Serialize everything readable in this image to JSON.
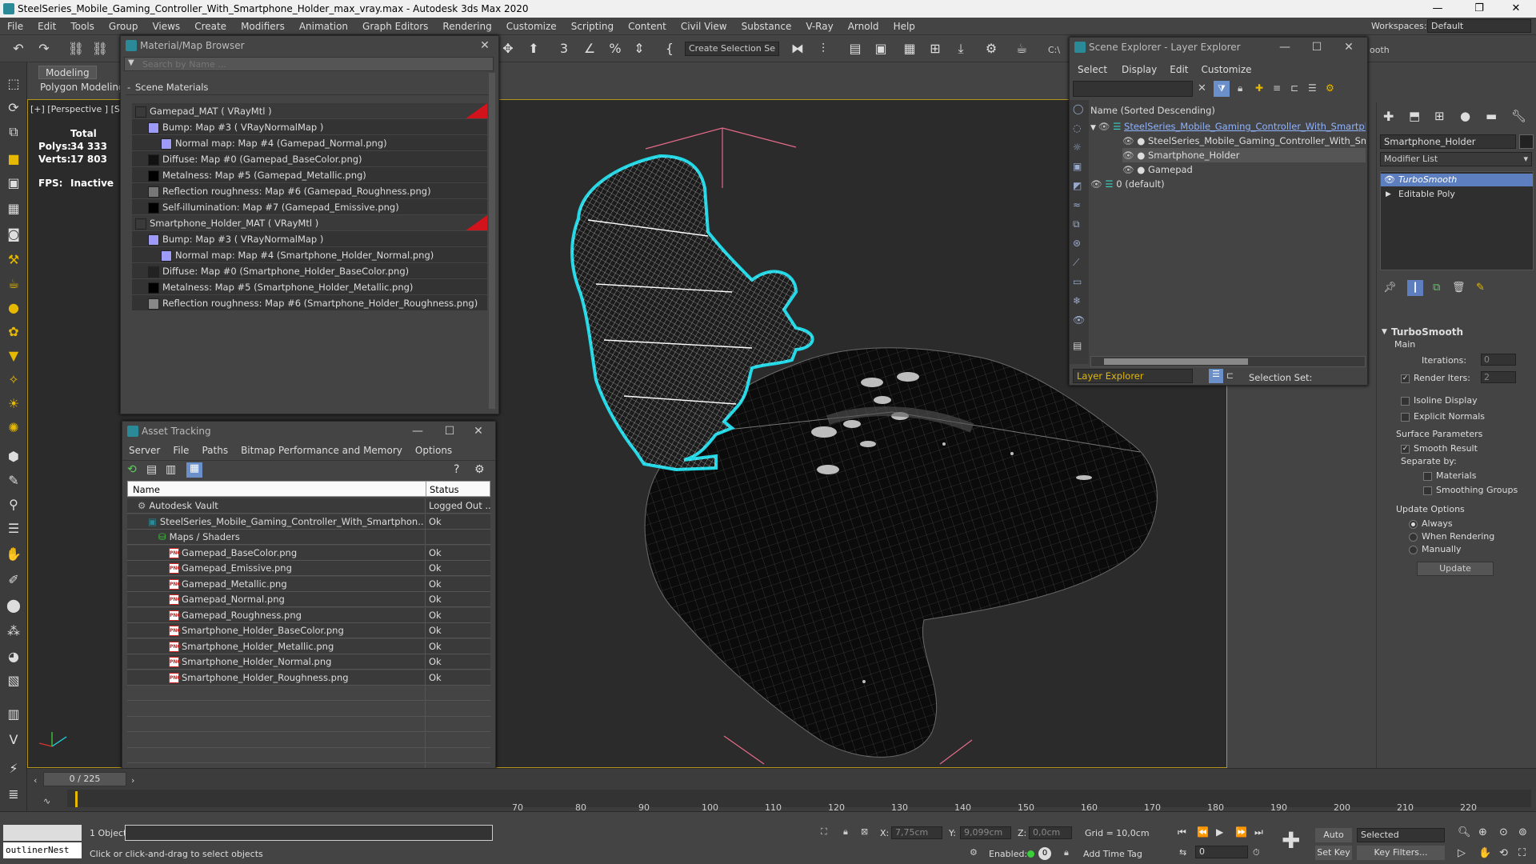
{
  "window": {
    "title": "SteelSeries_Mobile_Gaming_Controller_With_Smartphone_Holder_max_vray.max - Autodesk 3ds Max 2020",
    "workspace_label": "Workspaces:",
    "workspace_value": "Default"
  },
  "menu": [
    "File",
    "Edit",
    "Tools",
    "Group",
    "Views",
    "Create",
    "Modifiers",
    "Animation",
    "Graph Editors",
    "Rendering",
    "Customize",
    "Scripting",
    "Content",
    "Civil View",
    "Substance",
    "V-Ray",
    "Arnold",
    "Help"
  ],
  "toolbar": {
    "selection_set_placeholder": "Create Selection Se",
    "path_fragment": "C:\\",
    "path_fragment2": "ooth"
  },
  "ribbon": {
    "tab_modeling": "Modeling",
    "tab_polygon": "Polygon Modeling"
  },
  "viewport": {
    "label": "[+] [Perspective ] [St",
    "stats_total": "Total",
    "polys_label": "Polys:",
    "polys_value": "34 333",
    "verts_label": "Verts:",
    "verts_value": "17 803",
    "fps_label": "FPS:",
    "fps_value": "Inactive"
  },
  "material_browser": {
    "title": "Material/Map Browser",
    "search_placeholder": "Search by Name ...",
    "section": "Scene Materials",
    "rows": [
      {
        "text": "Gamepad_MAT  ( VRayMtl )",
        "indent": 0,
        "swatch": "#3a3a3a",
        "parent": true
      },
      {
        "text": "Bump: Map #3  ( VRayNormalMap )",
        "indent": 1,
        "swatch": "#9d9bf7"
      },
      {
        "text": "Normal map: Map #4 (Gamepad_Normal.png)",
        "indent": 2,
        "swatch": "#9d9bf7"
      },
      {
        "text": "Diffuse: Map #0 (Gamepad_BaseColor.png)",
        "indent": 1,
        "swatch": "#111111"
      },
      {
        "text": "Metalness: Map #5 (Gamepad_Metallic.png)",
        "indent": 1,
        "swatch": "#000000"
      },
      {
        "text": "Reflection roughness: Map #6 (Gamepad_Roughness.png)",
        "indent": 1,
        "swatch": "#777777"
      },
      {
        "text": "Self-illumination: Map #7 (Gamepad_Emissive.png)",
        "indent": 1,
        "swatch": "#000000"
      },
      {
        "text": "Smartphone_Holder_MAT  ( VRayMtl )",
        "indent": 0,
        "swatch": "#3a3a3a",
        "parent": true
      },
      {
        "text": "Bump: Map #3  ( VRayNormalMap )",
        "indent": 1,
        "swatch": "#9d9bf7"
      },
      {
        "text": "Normal map: Map #4 (Smartphone_Holder_Normal.png)",
        "indent": 2,
        "swatch": "#9d9bf7"
      },
      {
        "text": "Diffuse: Map #0 (Smartphone_Holder_BaseColor.png)",
        "indent": 1,
        "swatch": "#222222"
      },
      {
        "text": "Metalness: Map #5 (Smartphone_Holder_Metallic.png)",
        "indent": 1,
        "swatch": "#000000"
      },
      {
        "text": "Reflection roughness: Map #6 (Smartphone_Holder_Roughness.png)",
        "indent": 1,
        "swatch": "#888888"
      }
    ]
  },
  "asset_tracking": {
    "title": "Asset Tracking",
    "menu": [
      "Server",
      "File",
      "Paths",
      "Bitmap Performance and Memory",
      "Options"
    ],
    "col_name": "Name",
    "col_status": "Status",
    "rows": [
      {
        "name": "Autodesk Vault",
        "status": "Logged Out ...",
        "indent": 1,
        "icon": "vault"
      },
      {
        "name": "SteelSeries_Mobile_Gaming_Controller_With_Smartphon...",
        "status": "Ok",
        "indent": 2,
        "icon": "max"
      },
      {
        "name": "Maps / Shaders",
        "status": "",
        "indent": 3,
        "icon": "folder"
      },
      {
        "name": "Gamepad_BaseColor.png",
        "status": "Ok",
        "indent": 4,
        "icon": "png"
      },
      {
        "name": "Gamepad_Emissive.png",
        "status": "Ok",
        "indent": 4,
        "icon": "png"
      },
      {
        "name": "Gamepad_Metallic.png",
        "status": "Ok",
        "indent": 4,
        "icon": "png"
      },
      {
        "name": "Gamepad_Normal.png",
        "status": "Ok",
        "indent": 4,
        "icon": "png"
      },
      {
        "name": "Gamepad_Roughness.png",
        "status": "Ok",
        "indent": 4,
        "icon": "png"
      },
      {
        "name": "Smartphone_Holder_BaseColor.png",
        "status": "Ok",
        "indent": 4,
        "icon": "png"
      },
      {
        "name": "Smartphone_Holder_Metallic.png",
        "status": "Ok",
        "indent": 4,
        "icon": "png"
      },
      {
        "name": "Smartphone_Holder_Normal.png",
        "status": "Ok",
        "indent": 4,
        "icon": "png"
      },
      {
        "name": "Smartphone_Holder_Roughness.png",
        "status": "Ok",
        "indent": 4,
        "icon": "png"
      }
    ]
  },
  "scene_explorer": {
    "title": "Scene Explorer - Layer Explorer",
    "menu": [
      "Select",
      "Display",
      "Edit",
      "Customize"
    ],
    "column_header": "Name (Sorted Descending)",
    "rows": [
      {
        "text": "SteelSeries_Mobile_Gaming_Controller_With_Smartphone_Ho",
        "indent": 0,
        "selected": true,
        "underline": true
      },
      {
        "text": "SteelSeries_Mobile_Gaming_Controller_With_Smartphone",
        "indent": 1
      },
      {
        "text": "Smartphone_Holder",
        "indent": 1,
        "highlight": true
      },
      {
        "text": "Gamepad",
        "indent": 1
      },
      {
        "text": "0 (default)",
        "indent": 0
      }
    ],
    "footer_dropdown": "Layer Explorer",
    "selection_set_label": "Selection Set:"
  },
  "command_panel": {
    "object_name": "Smartphone_Holder",
    "modifier_list": "Modifier List",
    "stack": [
      "TurboSmooth",
      "Editable Poly"
    ],
    "rollout_title": "TurboSmooth",
    "main_label": "Main",
    "iterations_label": "Iterations:",
    "iterations_value": "0",
    "render_iters_label": "Render Iters:",
    "render_iters_value": "2",
    "isoline_label": "Isoline Display",
    "explicit_normals_label": "Explicit Normals",
    "surface_params_label": "Surface Parameters",
    "smooth_result_label": "Smooth Result",
    "separate_by_label": "Separate by:",
    "materials_label": "Materials",
    "smoothing_groups_label": "Smoothing Groups",
    "update_options_label": "Update Options",
    "always_label": "Always",
    "when_rendering_label": "When Rendering",
    "manually_label": "Manually",
    "update_button": "Update"
  },
  "timeline": {
    "frame_counter": "0 / 225",
    "ticks": [
      "70",
      "80",
      "90",
      "100",
      "110",
      "120",
      "130",
      "140",
      "150",
      "160",
      "170",
      "180",
      "190",
      "200",
      "210",
      "220"
    ]
  },
  "status": {
    "maxscript_listener": "outlinerNest",
    "objects_selected": "1 Object",
    "prompt": "Click or click-and-drag to select objects",
    "x_label": "X:",
    "x_value": "7,75cm",
    "y_label": "Y:",
    "y_value": "9,099cm",
    "z_label": "Z:",
    "z_value": "0,0cm",
    "grid": "Grid = 10,0cm",
    "enabled_label": "Enabled:",
    "add_time_tag": "Add Time Tag",
    "auto_key": "Auto Key",
    "selected_dropdown": "Selected",
    "set_key": "Set Key",
    "key_filters": "Key Filters...",
    "frame_field": "0"
  },
  "colors": {
    "viewport_bg": "#2b2b2b",
    "selection_outline": "#22d8e6",
    "wire_white": "#ffffff",
    "helper_pink": "#e66a8a",
    "flag_red": "#d3131c",
    "icon_yellow": "#e6b800",
    "viewport_border": "#b3951e"
  }
}
